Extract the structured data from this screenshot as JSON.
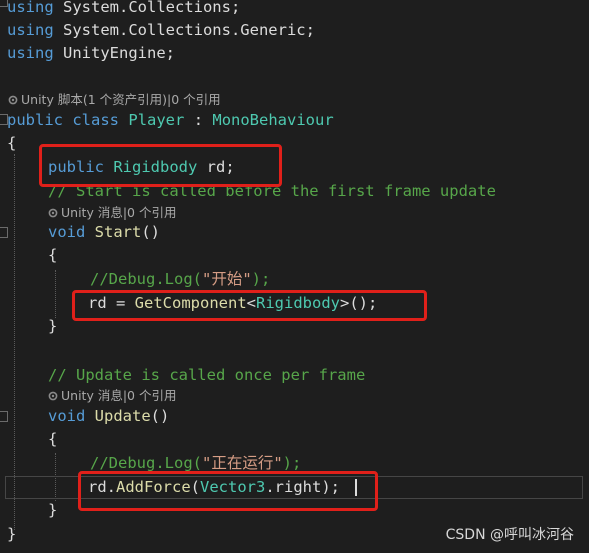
{
  "code": {
    "line1": {
      "kw": "using",
      "rest": " System.Collections;"
    },
    "line2": {
      "kw": "using",
      "rest": " System.Collections.Generic;"
    },
    "line3": {
      "kw": "using",
      "rest": " UnityEngine;"
    },
    "hint_class": "Unity 脚本(1 个资产引用)|0 个引用",
    "class_decl": {
      "kw1": "public",
      "kw2": "class",
      "name": "Player",
      "sep": " : ",
      "base": "MonoBehaviour"
    },
    "open_brace_1": "{",
    "field": {
      "kw": "public",
      "type": "Rigidbody",
      "name": " rd;"
    },
    "comment_start": "// Start is called before the first frame update",
    "hint_start": "Unity 消息|0 个引用",
    "start_decl": {
      "kw": "void",
      "name": "Start",
      "parens": "()"
    },
    "open_brace_2": "{",
    "comment_debug1": {
      "pre": "//Debug.Log(",
      "str": "\"开始\"",
      "post": ");"
    },
    "getcomponent": {
      "lhs": "rd = ",
      "fn": "GetComponent",
      "lt": "<",
      "type": "Rigidbody",
      "rest": ">();"
    },
    "close_brace_2": "}",
    "comment_update": "// Update is called once per frame",
    "hint_update": "Unity 消息|0 个引用",
    "update_decl": {
      "kw": "void",
      "name": "Update",
      "parens": "()"
    },
    "open_brace_3": "{",
    "comment_debug2": {
      "pre": "//Debug.Log(",
      "str": "\"正在运行\"",
      "post": ");"
    },
    "addforce": {
      "obj": "rd.",
      "fn": "AddForce",
      "open": "(",
      "type": "Vector3",
      "rest": ".right);"
    },
    "close_brace_3": "}",
    "close_brace_1": "}"
  },
  "watermark": "CSDN @呼叫冰河谷",
  "colors": {
    "background": "#1e1e1e",
    "keyword": "#569cd6",
    "type": "#4ec9b0",
    "method": "#dcdcaa",
    "comment": "#57a64a",
    "string": "#d69d85",
    "highlight_box": "#e0201a"
  }
}
